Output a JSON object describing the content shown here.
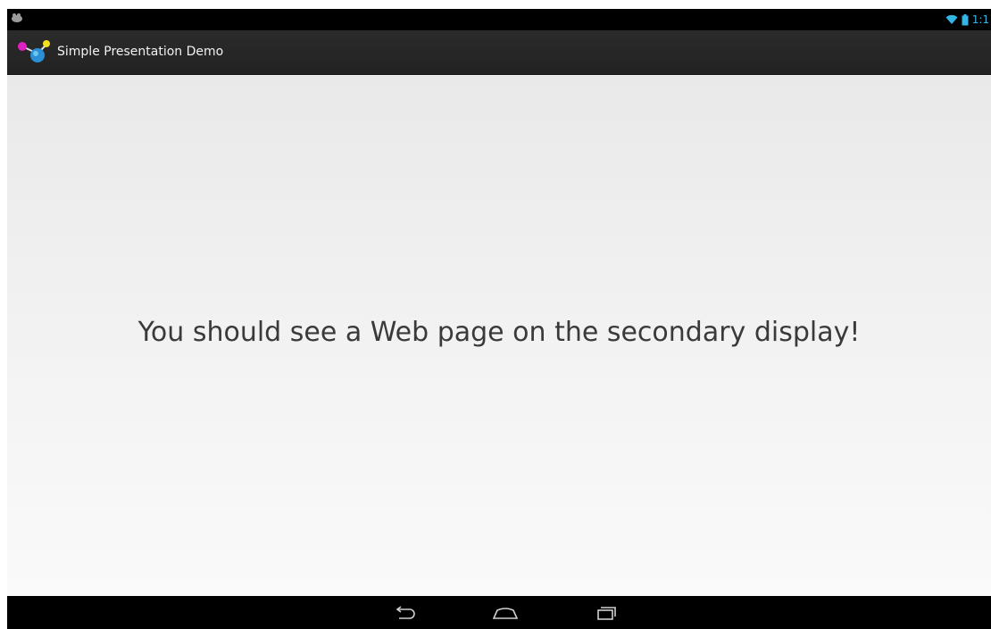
{
  "status_bar": {
    "time": "1:1",
    "icons": [
      "notification-icon",
      "wifi-icon",
      "battery-icon"
    ],
    "accent_color": "#33b5e5"
  },
  "action_bar": {
    "title": "Simple Presentation Demo",
    "icon": "app-logo-icon"
  },
  "main": {
    "message": "You should see a Web page on the secondary display!"
  },
  "nav_bar": {
    "buttons": [
      "back-icon",
      "home-icon",
      "recent-apps-icon"
    ]
  }
}
